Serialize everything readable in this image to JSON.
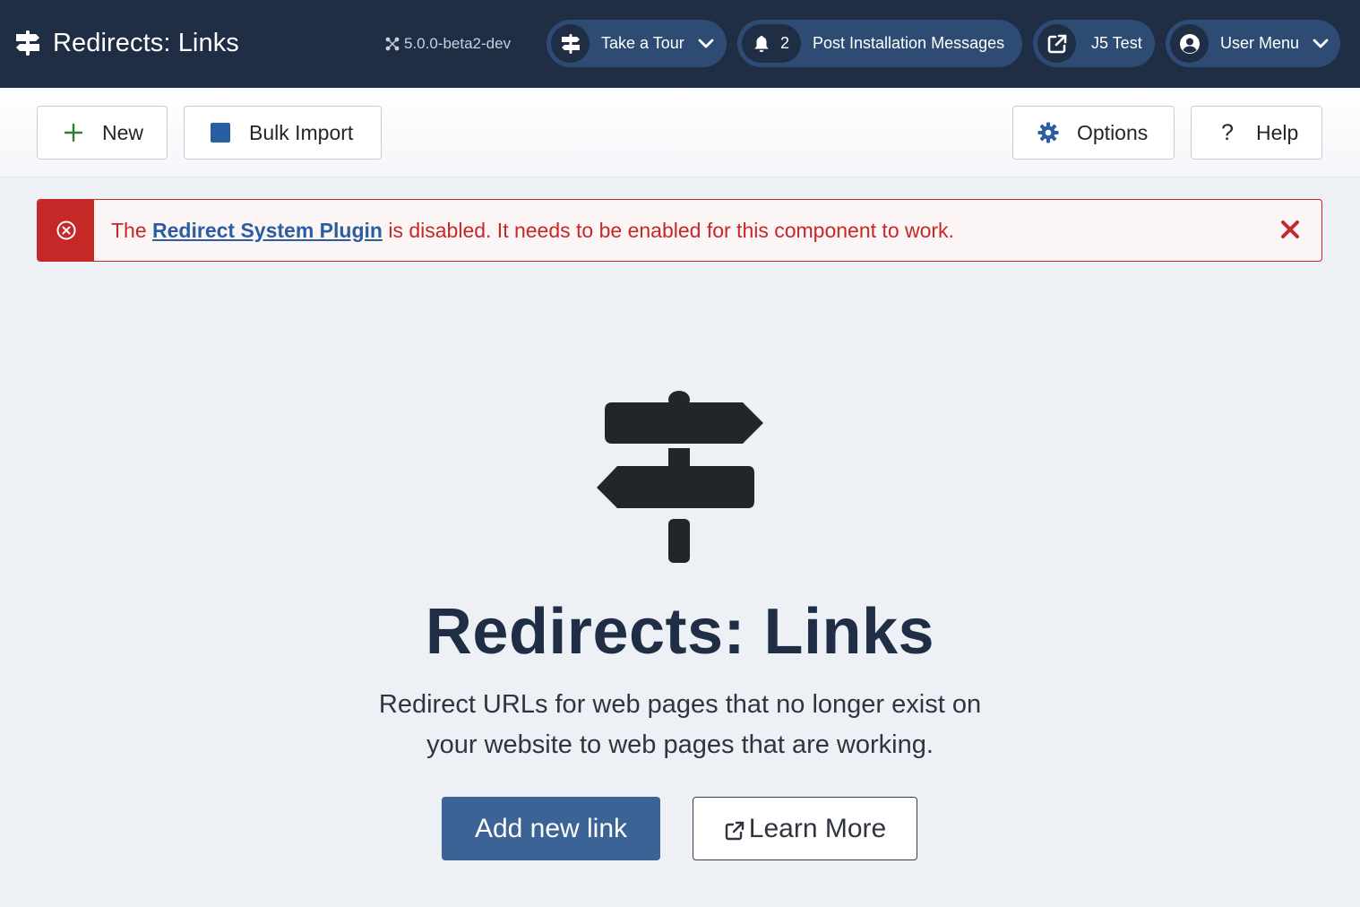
{
  "header": {
    "title": "Redirects: Links",
    "title_icon": "signpost-icon",
    "version": "5.0.0-beta2-dev",
    "tour": {
      "label": "Take a Tour",
      "icon": "signpost-icon"
    },
    "post_install": {
      "count": "2",
      "label": "Post Installation Messages",
      "icon": "bell-icon"
    },
    "site": {
      "label": "J5 Test",
      "icon": "external-link-icon"
    },
    "user_menu": {
      "label": "User Menu",
      "icon": "user-circle-icon"
    }
  },
  "toolbar": {
    "new_label": "New",
    "bulk_import_label": "Bulk Import",
    "options_label": "Options",
    "help_label": "Help",
    "help_glyph": "?"
  },
  "alert": {
    "prefix": "The ",
    "link_text": "Redirect System Plugin",
    "suffix": " is disabled. It needs to be enabled for this component to work."
  },
  "empty_state": {
    "title": "Redirects: Links",
    "description": "Redirect URLs for web pages that no longer exist on your website to web pages that are working.",
    "add_button_label": "Add new link",
    "learn_more_label": "Learn More"
  },
  "colors": {
    "header_bg": "#1f2d45",
    "header_pill": "#2e4b73",
    "danger": "#c52827",
    "primary": "#3b6395",
    "link": "#2a5ea2",
    "page_bg": "#edf1f6"
  }
}
